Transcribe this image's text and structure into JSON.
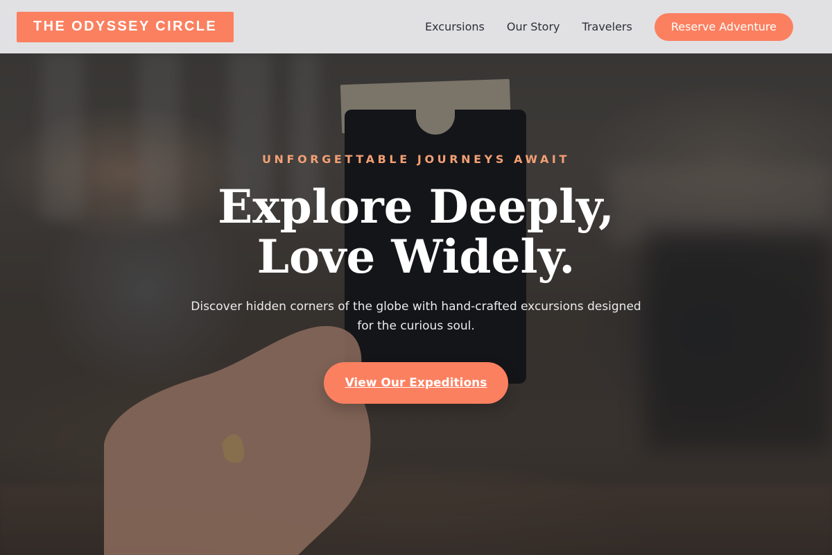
{
  "header": {
    "logo_text": "THE ODYSSEY CIRCLE",
    "nav": [
      {
        "label": "Excursions"
      },
      {
        "label": "Our Story"
      },
      {
        "label": "Travelers"
      }
    ],
    "cta_label": "Reserve Adventure"
  },
  "hero": {
    "eyebrow": "UNFORGETTABLE JOURNEYS AWAIT",
    "headline_line1": "Explore Deeply,",
    "headline_line2": "Love Widely.",
    "subtext": "Discover hidden corners of the globe with hand-crafted excursions designed for the curious soul.",
    "button_label": "View Our Expeditions"
  },
  "colors": {
    "accent": "#fb8060",
    "eyebrow": "#f4a074",
    "header_bg": "#e8e8ea",
    "nav_text": "#2c2f38"
  }
}
